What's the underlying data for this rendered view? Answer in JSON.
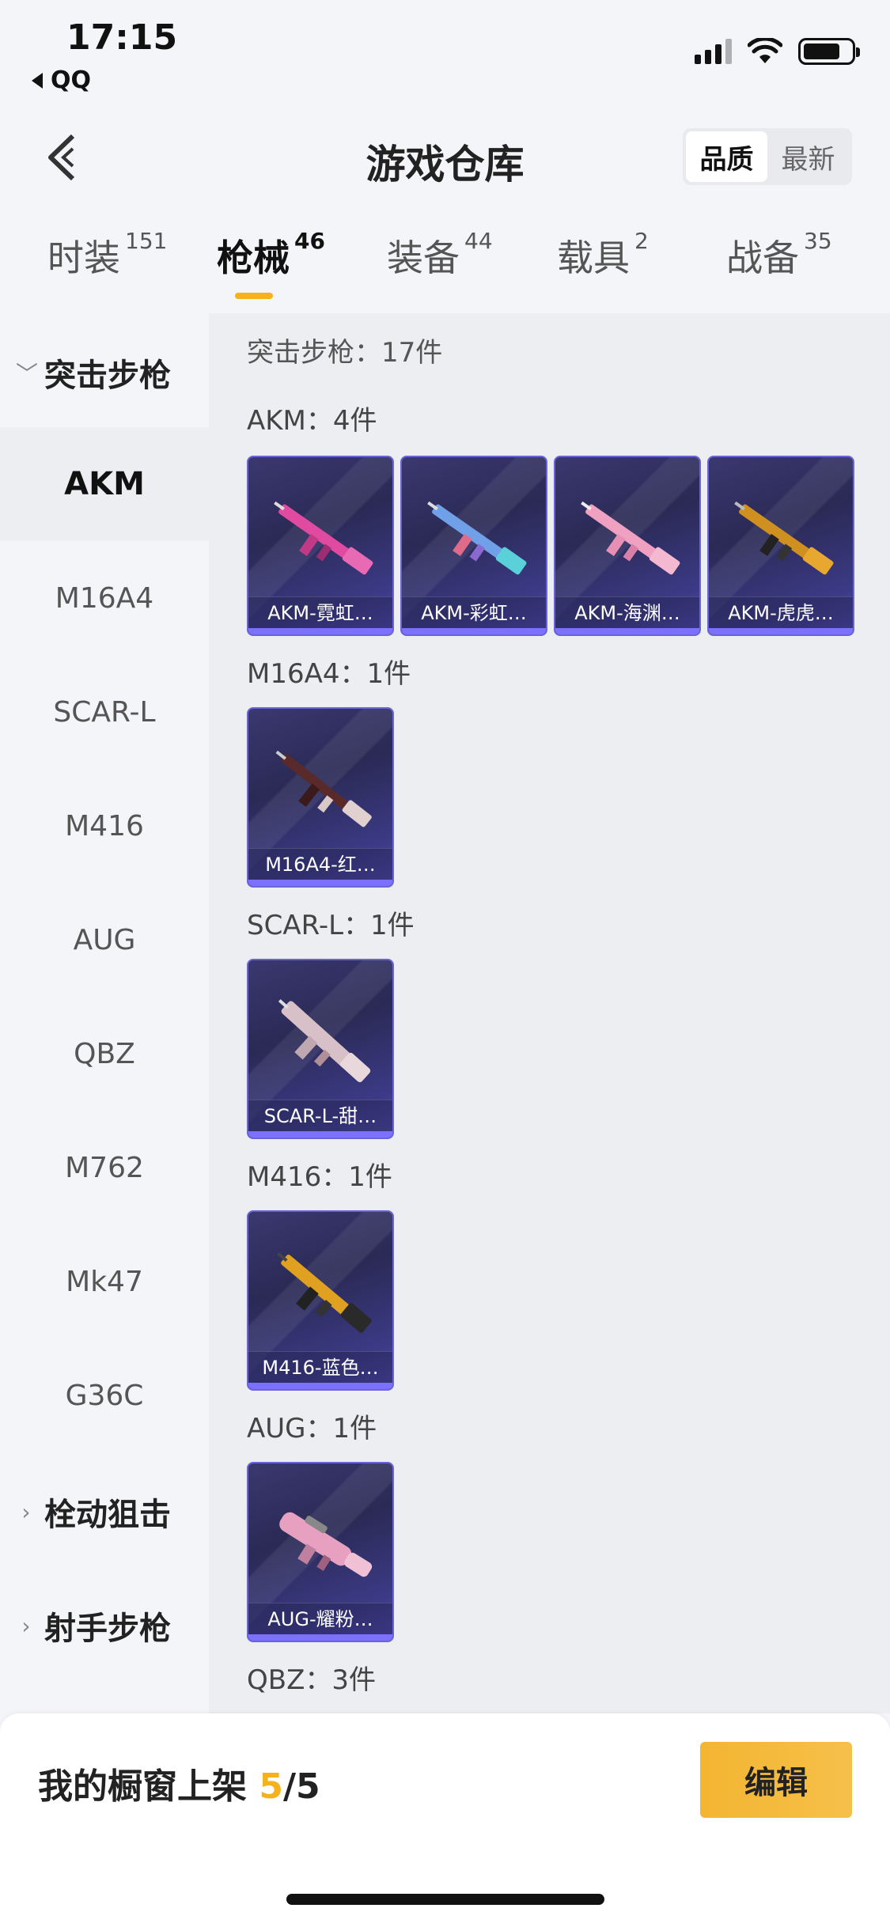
{
  "status_bar": {
    "time": "17:15",
    "back_app": "QQ"
  },
  "header": {
    "title": "游戏仓库",
    "sort": {
      "options": [
        "品质",
        "最新"
      ],
      "selected": "品质"
    }
  },
  "tabs": [
    {
      "label": "时装",
      "count": "151"
    },
    {
      "label": "枪械",
      "count": "46",
      "active": true
    },
    {
      "label": "装备",
      "count": "44"
    },
    {
      "label": "载具",
      "count": "2"
    },
    {
      "label": "战备",
      "count": "35"
    }
  ],
  "sidebar": {
    "group_assault": "突击步枪",
    "items": [
      "AKM",
      "M16A4",
      "SCAR-L",
      "M416",
      "AUG",
      "QBZ",
      "M762",
      "Mk47",
      "G36C"
    ],
    "group_bolt": "栓动狙击",
    "group_marksman": "射手步枪"
  },
  "content": {
    "category_title": "突击步枪：17件",
    "groups": [
      {
        "title": "AKM：4件",
        "cards": [
          "AKM-霓虹…",
          "AKM-彩虹…",
          "AKM-海渊…",
          "AKM-虎虎…"
        ]
      },
      {
        "title": "M16A4：1件",
        "cards": [
          "M16A4-红…"
        ]
      },
      {
        "title": "SCAR-L：1件",
        "cards": [
          "SCAR-L-甜…"
        ]
      },
      {
        "title": "M416：1件",
        "cards": [
          "M416-蓝色…"
        ]
      },
      {
        "title": "AUG：1件",
        "cards": [
          "AUG-耀粉…"
        ]
      },
      {
        "title": "QBZ：3件",
        "cards": []
      }
    ]
  },
  "bottom": {
    "showcase_label": "我的橱窗上架",
    "showcase_current": "5",
    "showcase_total": "/5",
    "edit_label": "编辑"
  },
  "colors": {
    "accent": "#f5b21a",
    "card_border": "#6b63d8"
  }
}
